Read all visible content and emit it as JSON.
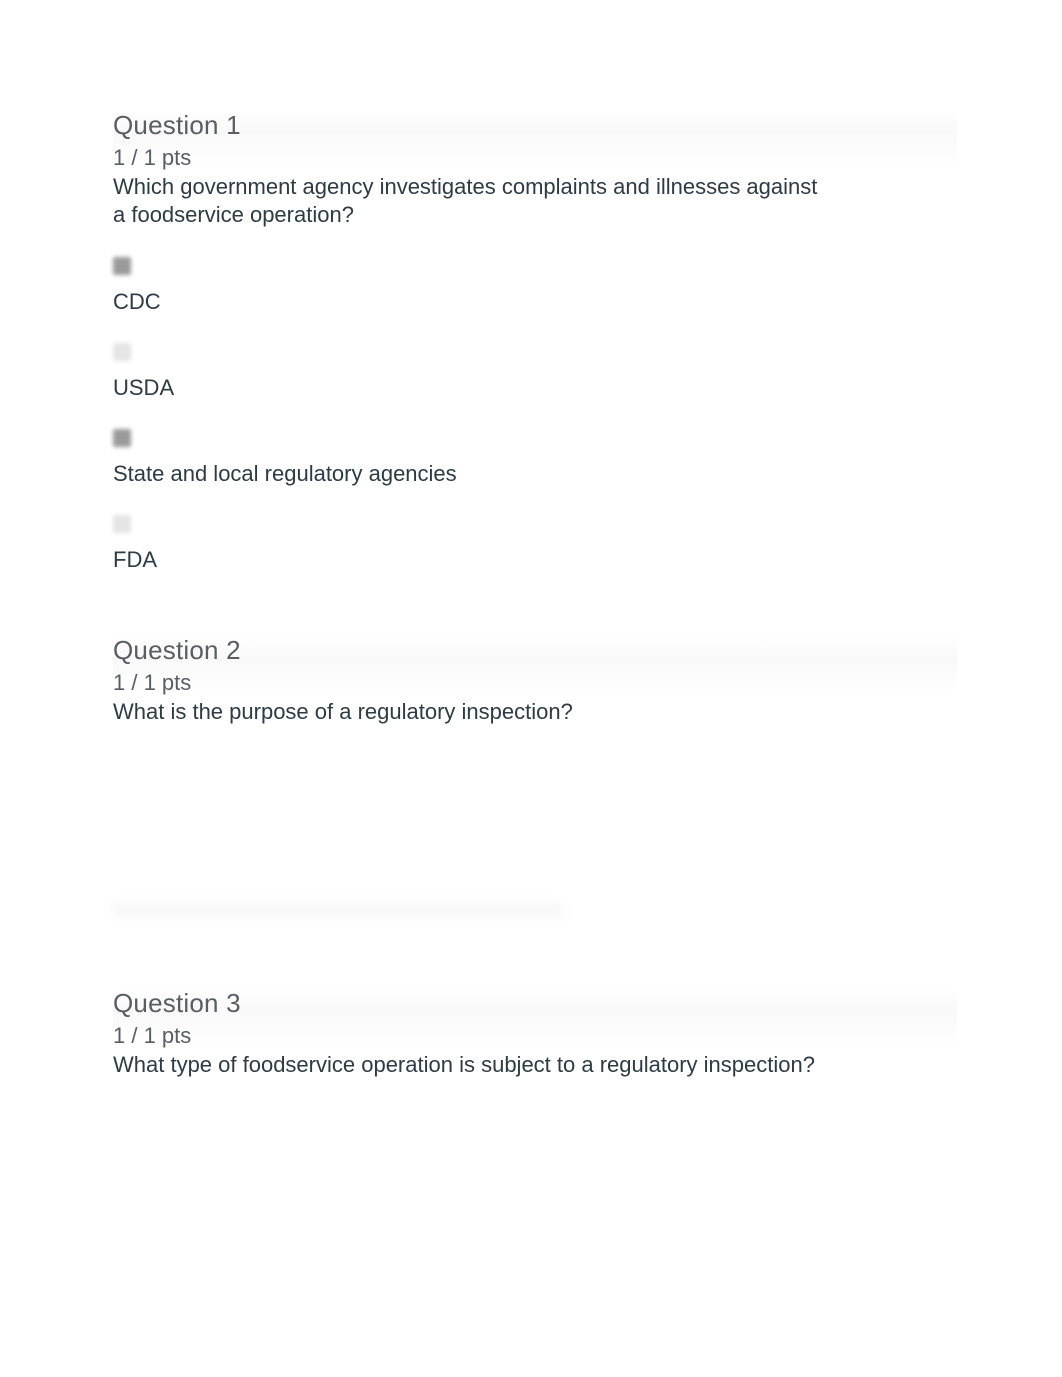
{
  "questions": [
    {
      "title": "Question 1",
      "points": "1 / 1 pts",
      "text": "Which government agency investigates complaints and illnesses against a foodservice operation?",
      "answers": [
        {
          "label": "CDC",
          "marker": "dark"
        },
        {
          "label": "USDA",
          "marker": "light"
        },
        {
          "label": "State and local regulatory agencies",
          "marker": "dark"
        },
        {
          "label": "FDA",
          "marker": "light"
        }
      ]
    },
    {
      "title": "Question 2",
      "points": "1 / 1 pts",
      "text": "What is the purpose of a regulatory inspection?",
      "answers": []
    },
    {
      "title": "Question 3",
      "points": "1 / 1 pts",
      "text": "What type of foodservice operation is subject to a regulatory inspection?",
      "answers": []
    }
  ]
}
